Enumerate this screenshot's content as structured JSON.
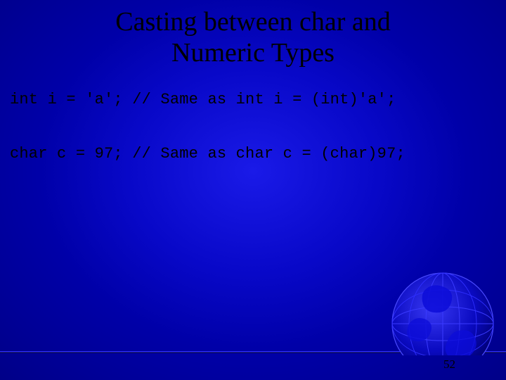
{
  "slide": {
    "title_line1": "Casting between char and",
    "title_line2": "Numeric Types",
    "code_line1": "int i = 'a'; // Same as int i = (int)'a';",
    "code_line2": "char c = 97; // Same as char c = (char)97;",
    "page_number": "52"
  }
}
